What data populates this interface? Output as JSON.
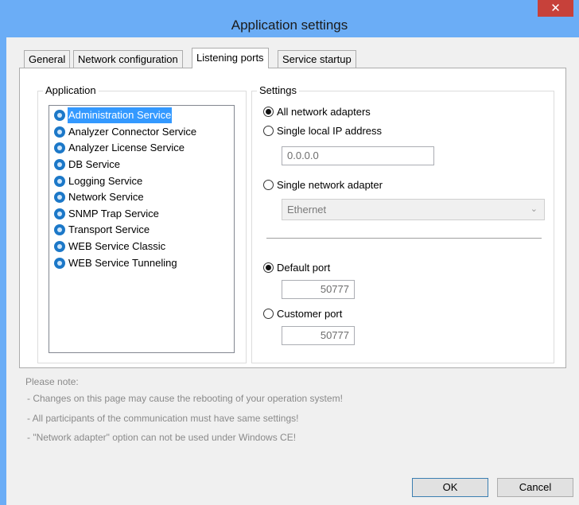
{
  "window": {
    "title": "Application settings",
    "close_glyph": "✕"
  },
  "tabs": [
    {
      "label": "General"
    },
    {
      "label": "Network configuration"
    },
    {
      "label": "Listening ports",
      "active": true
    },
    {
      "label": "Service startup"
    }
  ],
  "application_group": {
    "label": "Application",
    "services": [
      {
        "label": "Administration Service",
        "selected": true
      },
      {
        "label": "Analyzer Connector Service"
      },
      {
        "label": "Analyzer License Service"
      },
      {
        "label": "DB Service"
      },
      {
        "label": "Logging Service"
      },
      {
        "label": "Network Service"
      },
      {
        "label": "SNMP Trap Service"
      },
      {
        "label": "Transport Service"
      },
      {
        "label": "WEB Service Classic"
      },
      {
        "label": "WEB Service Tunneling"
      }
    ],
    "icon": "service-gear-icon"
  },
  "settings_group": {
    "label": "Settings",
    "all_adapters_label": "All network adapters",
    "single_ip_label": "Single local IP address",
    "ip_value": "0.0.0.0",
    "single_adapter_label": "Single network adapter",
    "adapter_value": "Ethernet",
    "default_port_label": "Default port",
    "default_port_value": "50777",
    "customer_port_label": "Customer port",
    "customer_port_value": "50777"
  },
  "notes": {
    "heading": "Please note:",
    "lines": [
      "- Changes on this page may cause the rebooting of your operation system!",
      "- All participants of the communication must have same settings!",
      "- \"Network adapter\" option can not be used under Windows CE!"
    ]
  },
  "buttons": {
    "ok": "OK",
    "cancel": "Cancel"
  },
  "colors": {
    "titlebar": "#6badf6",
    "close": "#c7413a",
    "selection": "#3399ff"
  }
}
